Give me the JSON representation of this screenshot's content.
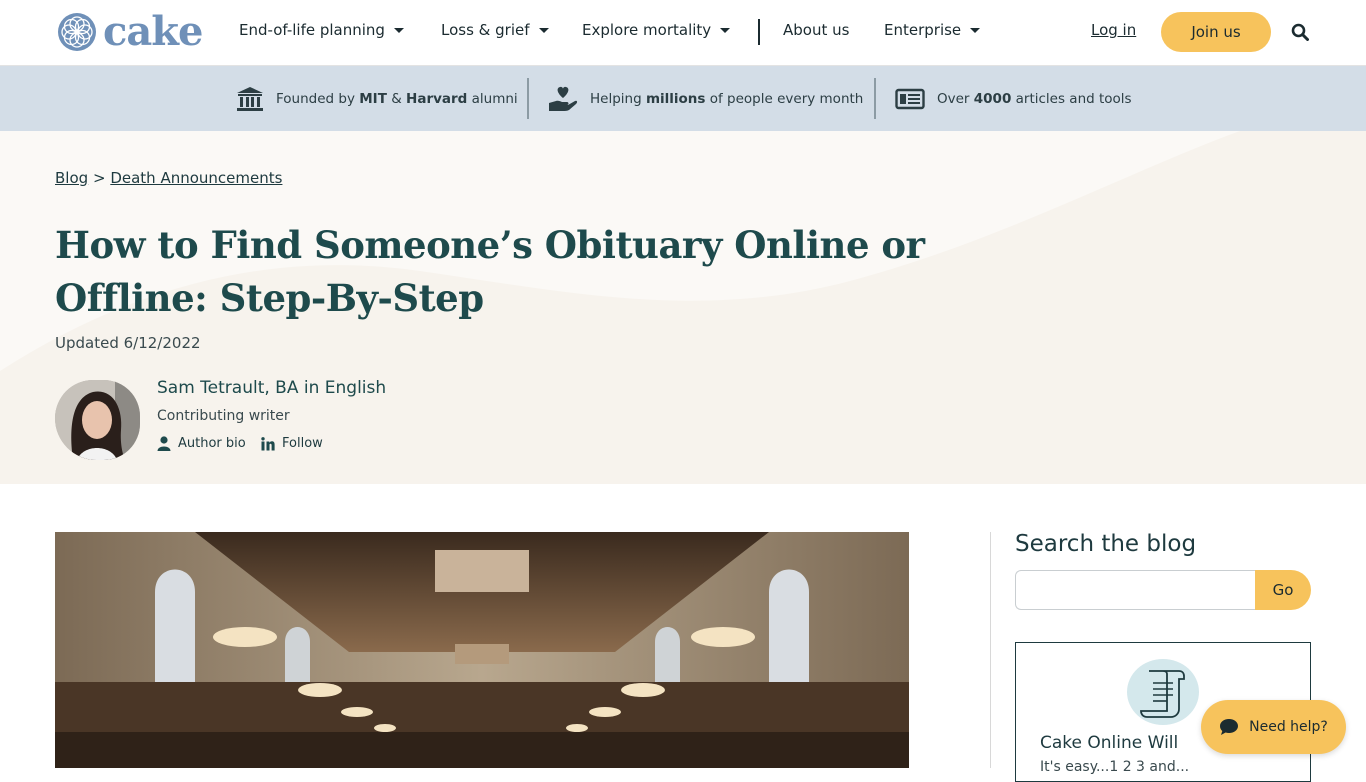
{
  "brand": {
    "name": "cake",
    "logo_color": "#6f90b8",
    "accent": "#f7c35c"
  },
  "nav": {
    "items": [
      {
        "label": "End-of-life planning",
        "dropdown": true
      },
      {
        "label": "Loss & grief",
        "dropdown": true
      },
      {
        "label": "Explore mortality",
        "dropdown": true
      },
      {
        "label": "About us",
        "dropdown": false
      },
      {
        "label": "Enterprise",
        "dropdown": true
      }
    ],
    "login": "Log in",
    "join": "Join us",
    "search_icon": "search-icon"
  },
  "trust": {
    "items": [
      {
        "icon": "institution-icon",
        "pre": "Founded by ",
        "b1": "MIT",
        "mid": " & ",
        "b2": "Harvard",
        "post": " alumni"
      },
      {
        "icon": "heart-hand-icon",
        "pre": "Helping ",
        "b1": "millions",
        "post": " of people every month"
      },
      {
        "icon": "articles-icon",
        "pre": "Over ",
        "b1": "4000",
        "post": " articles and tools"
      }
    ]
  },
  "hero": {
    "breadcrumb": {
      "first": "Blog",
      "sep": ">",
      "second": "Death Announcements"
    },
    "title": "How to Find Someone’s Obituary Online or Offline: Step-By-Step",
    "updated": "Updated 6/12/2022",
    "author": {
      "name": "Sam Tetrault, BA in English",
      "role": "Contributing writer",
      "bio_link": "Author bio",
      "follow_link": "Follow"
    }
  },
  "sidebar": {
    "search_title": "Search the blog",
    "search_placeholder": "",
    "go": "Go",
    "promo": {
      "title": "Cake Online Will",
      "subtitle": "It's easy...1 2 3 and..."
    }
  },
  "help": {
    "label": "Need help?"
  }
}
